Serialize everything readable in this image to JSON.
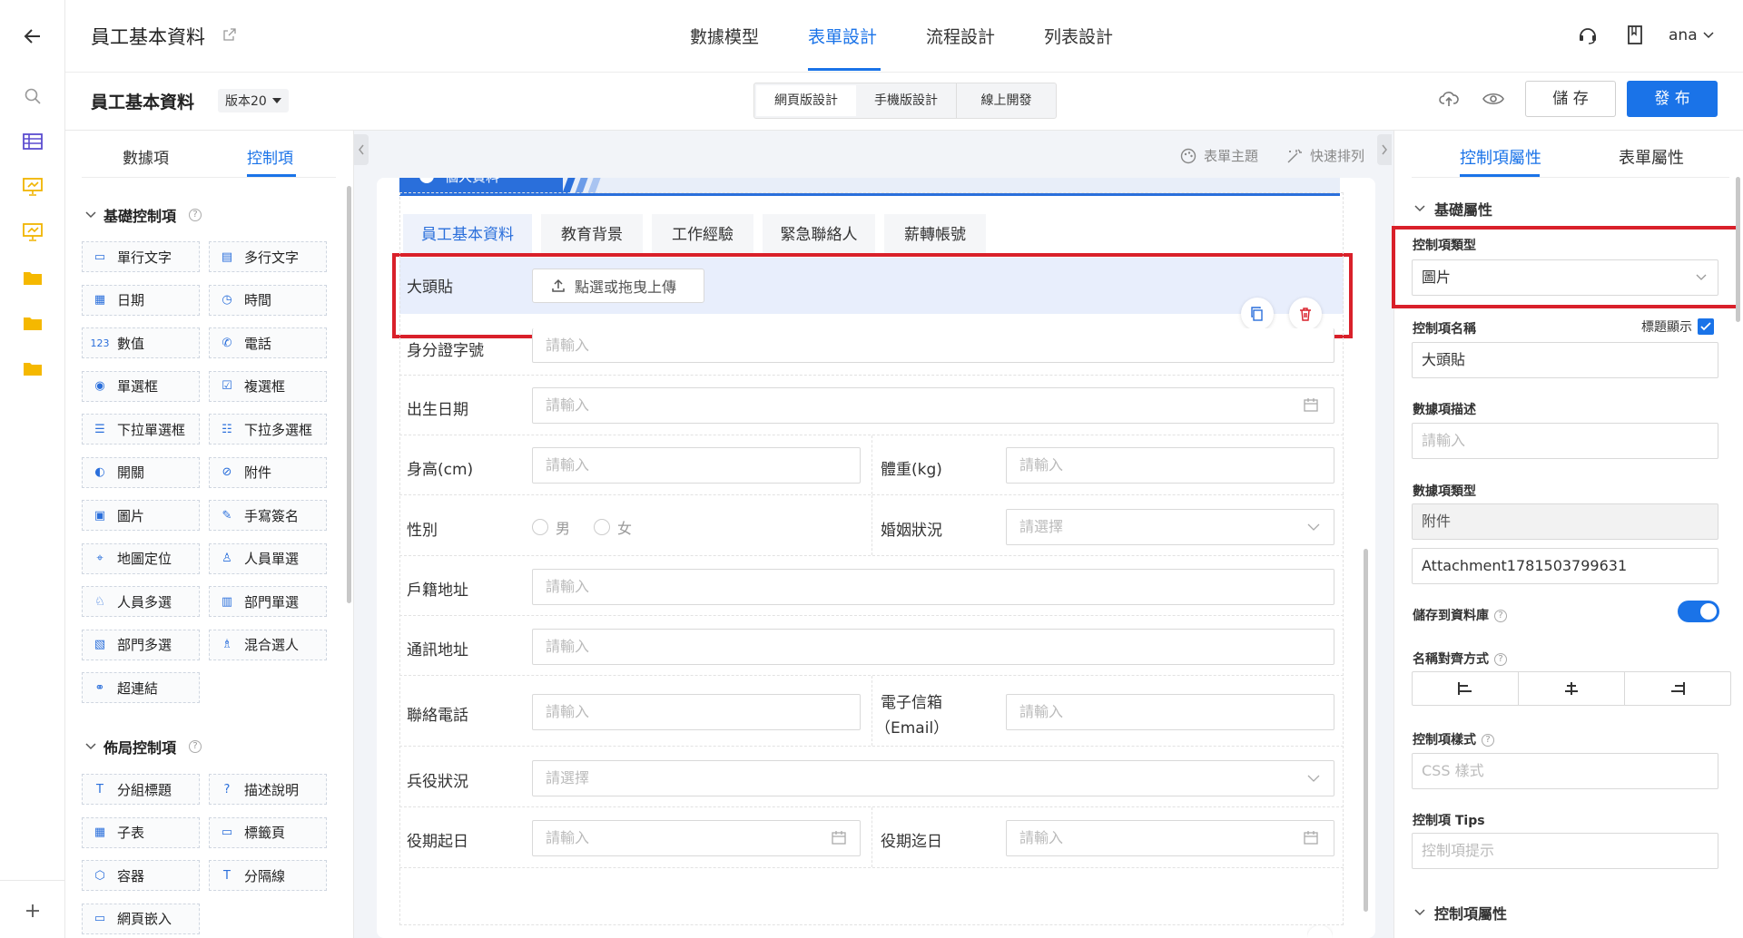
{
  "header": {
    "title": "員工基本資料",
    "tabs": [
      "數據模型",
      "表單設計",
      "流程設計",
      "列表設計"
    ],
    "active_tab": "表單設計",
    "user": "ana"
  },
  "subbar": {
    "form_name": "員工基本資料",
    "version": "版本20",
    "segments": [
      "網頁版設計",
      "手機版設計",
      "線上開發"
    ],
    "save_label": "儲 存",
    "publish_label": "發 布"
  },
  "left_panel": {
    "tabs": [
      "數據項",
      "控制項"
    ],
    "active_tab": "控制項",
    "basic_section": "基礎控制項",
    "basic_controls": [
      {
        "label": "單行文字",
        "icon": "single-line-icon"
      },
      {
        "label": "多行文字",
        "icon": "multi-line-icon"
      },
      {
        "label": "日期",
        "icon": "calendar-icon"
      },
      {
        "label": "時間",
        "icon": "clock-icon"
      },
      {
        "label": "數值",
        "icon": "number-icon"
      },
      {
        "label": "電話",
        "icon": "phone-icon"
      },
      {
        "label": "單選框",
        "icon": "radio-icon"
      },
      {
        "label": "複選框",
        "icon": "checkbox-icon"
      },
      {
        "label": "下拉單選框",
        "icon": "dropdown-single-icon"
      },
      {
        "label": "下拉多選框",
        "icon": "dropdown-multi-icon"
      },
      {
        "label": "開關",
        "icon": "toggle-icon"
      },
      {
        "label": "附件",
        "icon": "paperclip-icon"
      },
      {
        "label": "圖片",
        "icon": "image-icon"
      },
      {
        "label": "手寫簽名",
        "icon": "pen-icon"
      },
      {
        "label": "地圖定位",
        "icon": "map-pin-icon"
      },
      {
        "label": "人員單選",
        "icon": "person-icon"
      },
      {
        "label": "人員多選",
        "icon": "people-icon"
      },
      {
        "label": "部門單選",
        "icon": "department-icon"
      },
      {
        "label": "部門多選",
        "icon": "departments-icon"
      },
      {
        "label": "混合選人",
        "icon": "mixed-person-icon"
      },
      {
        "label": "超連結",
        "icon": "link-icon"
      }
    ],
    "layout_section": "佈局控制項",
    "layout_controls": [
      {
        "label": "分組標題",
        "icon": "title-icon"
      },
      {
        "label": "描述說明",
        "icon": "help-icon"
      },
      {
        "label": "子表",
        "icon": "table-icon"
      },
      {
        "label": "標籤頁",
        "icon": "tabs-icon"
      },
      {
        "label": "容器",
        "icon": "box-icon"
      },
      {
        "label": "分隔線",
        "icon": "divider-icon"
      },
      {
        "label": "網頁嵌入",
        "icon": "embed-icon"
      }
    ]
  },
  "canvas": {
    "toolbar": [
      "表單主題",
      "快速排列"
    ],
    "section_header": "個人資料",
    "tabs": [
      "員工基本資料",
      "教育背景",
      "工作經驗",
      "緊急聯絡人",
      "薪轉帳號"
    ],
    "active_tab": "員工基本資料",
    "upload_label": "大頭貼",
    "upload_button": "點選或拖曳上傳",
    "placeholder": "請輸入",
    "select_placeholder": "請選擇",
    "fields": {
      "id": "身分證字號",
      "birth": "出生日期",
      "height": "身高(cm)",
      "weight": "體重(kg)",
      "gender": "性別",
      "male": "男",
      "female": "女",
      "marital": "婚姻狀況",
      "domicile": "戶籍地址",
      "mailing": "通訊地址",
      "phone": "聯絡電話",
      "email_1": "電子信箱",
      "email_2": "（Email）",
      "military": "兵役狀況",
      "service_start": "役期起日",
      "service_end": "役期迄日"
    }
  },
  "right_panel": {
    "tabs": [
      "控制項屬性",
      "表單屬性"
    ],
    "active_tab": "控制項屬性",
    "basic_section": "基礎屬性",
    "control_type_label": "控制項類型",
    "control_type_value": "圖片",
    "control_name_label": "控制項名稱",
    "show_title_label": "標題顯示",
    "control_name_value": "大頭貼",
    "data_desc_label": "數據項描述",
    "data_desc_placeholder": "請輸入",
    "data_type_label": "數據項類型",
    "data_type_value": "附件",
    "data_code": "Attachment1781503799631",
    "save_db_label": "儲存到資料庫",
    "align_label": "名稱對齊方式",
    "style_label": "控制項樣式",
    "style_placeholder": "CSS 樣式",
    "tips_label": "控制項 Tips",
    "tips_placeholder": "控制項提示",
    "control_props_section": "控制項屬性"
  },
  "colors": {
    "accent": "#1a73e8",
    "highlight": "#d9202a",
    "selected_bg": "#e8eefc"
  }
}
